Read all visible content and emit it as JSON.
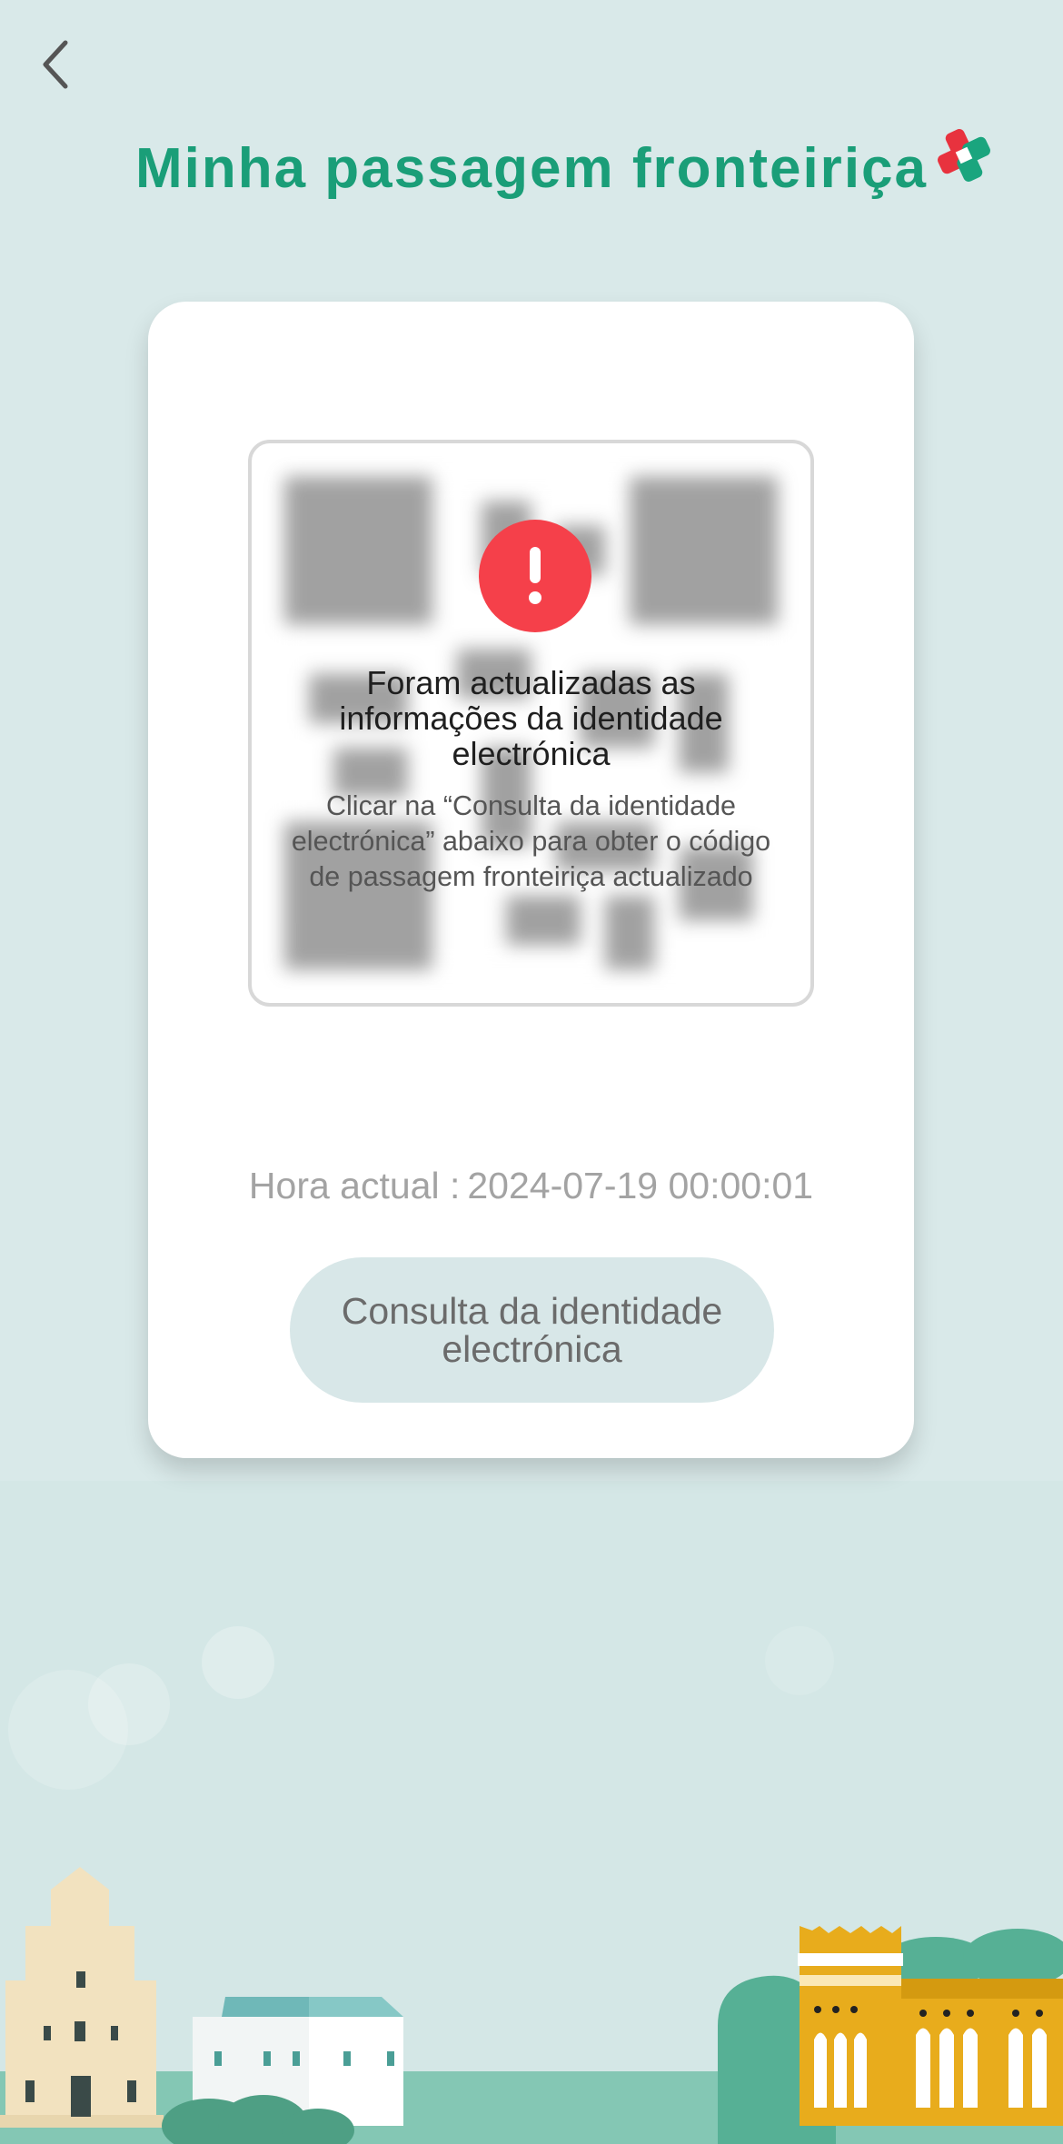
{
  "header": {
    "back_icon": "chevron-left-icon",
    "title": "Minha passagem fronteiriça",
    "logo_icon": "cross-logo-icon",
    "title_color": "#1a9e78"
  },
  "card": {
    "alert": {
      "icon": "exclamation-circle-icon",
      "icon_color": "#f5404a",
      "title": "Foram actualizadas as informações da identidade electrónica",
      "description": "Clicar na “Consulta da identidade electrónica” abaixo para obter o código de passagem fronteiriça actualizado"
    },
    "current_time_label": "Hora actual :",
    "current_time_value": "2024-07-19 00:00:01",
    "consult_button_label": "Consulta da identidade electrónica"
  },
  "colors": {
    "background": "#d9e9e9",
    "card": "#ffffff",
    "button_bg": "#d8e7e8"
  }
}
